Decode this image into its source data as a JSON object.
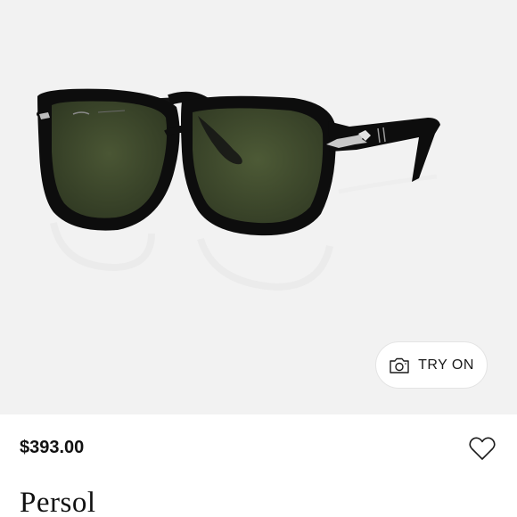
{
  "product": {
    "price": "$393.00",
    "brand": "Persol",
    "try_on_label": "TRY ON",
    "image_alt": "Persol sunglasses, black frame, green lenses"
  },
  "icons": {
    "camera": "camera-icon",
    "favorite": "heart-outline-icon"
  },
  "colors": {
    "frame": "#0d0d0d",
    "lens": "#3e4a2c",
    "hero_background": "#f2f2f2"
  }
}
